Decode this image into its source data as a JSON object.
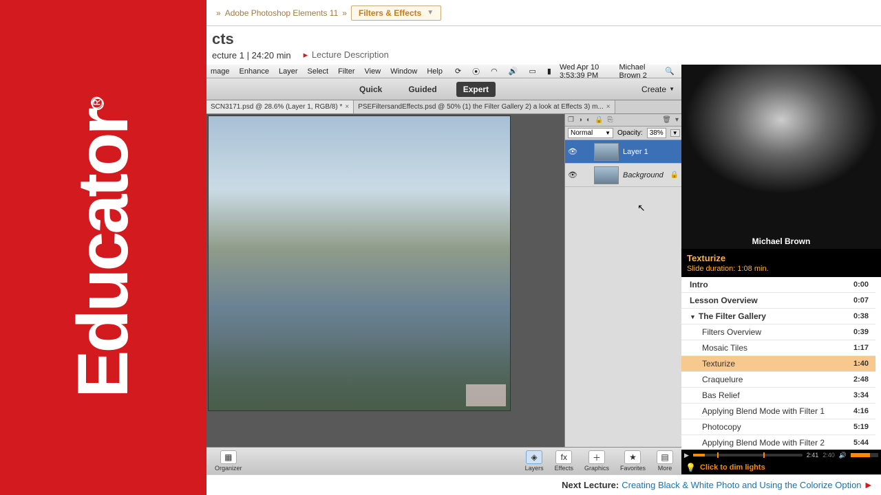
{
  "brand": "Educator",
  "breadcrumb": {
    "course": "Adobe Photoshop Elements 11",
    "dropdown": "Filters & Effects"
  },
  "page_title_suffix": "cts",
  "lecture_meta": "ecture 1 | 24:20 min",
  "lecture_desc_link": "Lecture Description",
  "mac_menu": {
    "items": [
      "mage",
      "Enhance",
      "Layer",
      "Select",
      "Filter",
      "View",
      "Window",
      "Help"
    ],
    "clock": "Wed Apr 10  3:53:39 PM",
    "user": "Michael Brown 2"
  },
  "modes": {
    "quick": "Quick",
    "guided": "Guided",
    "expert": "Expert"
  },
  "create_label": "Create",
  "doc_tabs": {
    "a": "SCN3171.psd @ 28.6% (Layer 1, RGB/8) *",
    "b": "PSEFiltersandEffects.psd @ 50% (1) the Filter Gallery 2) a look at Effects 3) m..."
  },
  "layers": {
    "blend": "Normal",
    "opacity_label": "Opacity:",
    "opacity_value": "38%",
    "layer1": "Layer 1",
    "background": "Background"
  },
  "bottom": {
    "organizer": "Organizer",
    "layers": "Layers",
    "effects": "Effects",
    "graphics": "Graphics",
    "favorites": "Favorites",
    "more": "More"
  },
  "video": {
    "presenter": "Michael Brown",
    "topic": "Texturize",
    "duration_line": "Slide duration: 1:08 min.",
    "time_cur": "2:41",
    "time_alt": "2:40",
    "dim_lights": "Click to dim lights"
  },
  "chapters": [
    {
      "label": "Intro",
      "time": "0:00",
      "level": "h1"
    },
    {
      "label": "Lesson Overview",
      "time": "0:07",
      "level": "h1"
    },
    {
      "label": "The Filter Gallery",
      "time": "0:38",
      "level": "h0"
    },
    {
      "label": "Filters Overview",
      "time": "0:39",
      "level": "sub"
    },
    {
      "label": "Mosaic Tiles",
      "time": "1:17",
      "level": "sub"
    },
    {
      "label": "Texturize",
      "time": "1:40",
      "level": "sub",
      "current": true
    },
    {
      "label": "Craquelure",
      "time": "2:48",
      "level": "sub"
    },
    {
      "label": "Bas Relief",
      "time": "3:34",
      "level": "sub"
    },
    {
      "label": "Applying Blend Mode with Filter 1",
      "time": "4:16",
      "level": "sub"
    },
    {
      "label": "Photocopy",
      "time": "5:19",
      "level": "sub"
    },
    {
      "label": "Applying Blend Mode with Filter 2",
      "time": "5:44",
      "level": "sub"
    }
  ],
  "next": {
    "label": "Next Lecture:",
    "title": "Creating Black & White Photo and Using the Colorize Option"
  }
}
